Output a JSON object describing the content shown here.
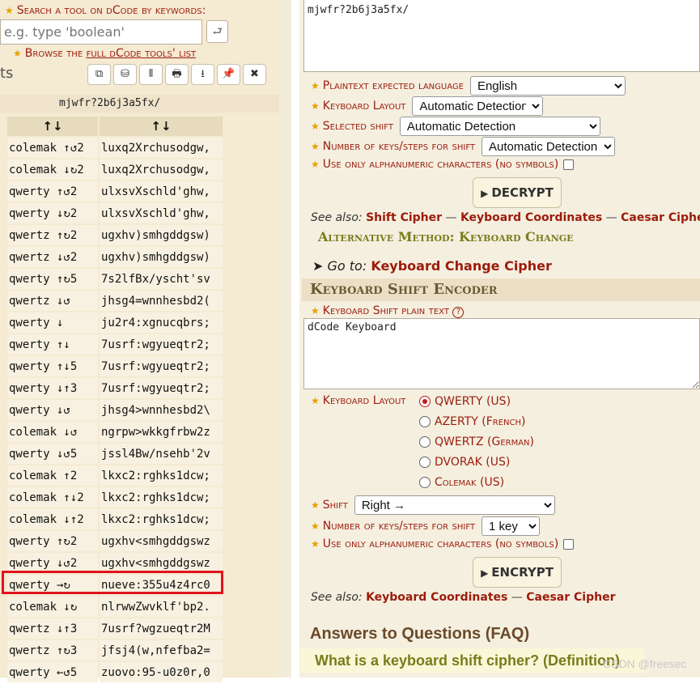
{
  "search": {
    "title": "Search a tool on dCode by keywords:",
    "placeholder": "e.g. type 'boolean'",
    "go_icon": "return-arrow-icon",
    "browse_prefix": "Browse the ",
    "browse_link": "full dCode tools' list"
  },
  "left_header": {
    "fragment": "ts",
    "tools": [
      {
        "name": "copy-icon",
        "glyph": "⧉"
      },
      {
        "name": "save-icon",
        "glyph": "⛁"
      },
      {
        "name": "columns-icon",
        "glyph": "⦀"
      },
      {
        "name": "print-icon",
        "glyph": "🖶"
      },
      {
        "name": "download-icon",
        "glyph": "⭳"
      },
      {
        "name": "pin-icon",
        "glyph": "📌"
      },
      {
        "name": "close-icon",
        "glyph": "✖"
      }
    ]
  },
  "result": {
    "input": "mjwfr?2b6j3a5fx/",
    "headers": [
      "↑↓",
      "↑↓"
    ],
    "rows": [
      [
        "colemak ↑↺2",
        "luxq2Xrchusodgw,"
      ],
      [
        "colemak ↓↻2",
        "luxq2Xrchusodgw,"
      ],
      [
        "qwerty ↑↺2",
        "ulxsvXschld'ghw,"
      ],
      [
        "qwerty ↓↻2",
        "ulxsvXschld'ghw,"
      ],
      [
        "qwertz ↑↻2",
        "ugxhv)smhgddgsw)"
      ],
      [
        "qwertz ↓↺2",
        "ugxhv)smhgddgsw)"
      ],
      [
        "qwerty ↑↻5",
        "7s2lfBx/yscht'sv"
      ],
      [
        "qwertz ↓↺",
        "jhsg4=wnnhesbd2("
      ],
      [
        "qwerty ↓",
        "ju2r4:xgnucqbrs;"
      ],
      [
        "qwerty ↑↓",
        "7usrf:wgyueqtr2;"
      ],
      [
        "qwerty ↑↓5",
        "7usrf:wgyueqtr2;"
      ],
      [
        "qwerty ↓↑3",
        "7usrf:wgyueqtr2;"
      ],
      [
        "qwerty ↓↺",
        "jhsg4>wnnhesbd2\\"
      ],
      [
        "colemak ↓↺",
        "ngrpw>wkkgfrbw2z"
      ],
      [
        "qwerty ↓↺5",
        "jssl4Bw/nsehb'2v"
      ],
      [
        "colemak ↑2",
        "lkxc2:rghks1dcw;"
      ],
      [
        "colemak ↑↓2",
        "lkxc2:rghks1dcw;"
      ],
      [
        "colemak ↓↑2",
        "lkxc2:rghks1dcw;"
      ],
      [
        "qwerty ↑↻2",
        "ugxhv<smhgddgswz"
      ],
      [
        "qwerty ↓↺2",
        "ugxhv<smhgddgswz"
      ],
      [
        "qwerty →↻",
        "nueve:355u4z4rc0"
      ],
      [
        "colemak ↓↻",
        "nlrwwZwvklf'bp2."
      ],
      [
        "qwertz ↓↑3",
        "7usrf?wgzueqtr2M"
      ],
      [
        "qwertz ↑↻3",
        "jfsj4(w,nfefba2="
      ],
      [
        "qwerty ←↺5",
        "zuovo:95-u0z0r,0"
      ]
    ]
  },
  "decoder": {
    "ciphertext": "mjwfr?2b6j3a5fx/",
    "plaintext_lang_label": "Plaintext expected language",
    "plaintext_lang_value": "English",
    "layout_label": "Keyboard Layout",
    "layout_value": "Automatic Detection",
    "shift_label": "Selected shift",
    "shift_value": "Automatic Detection",
    "steps_label": "Number of keys/steps for shift",
    "steps_value": "Automatic Detection",
    "alnum_label": "Use only alphanumeric characters (no symbols)",
    "decrypt_label": "DECRYPT",
    "see_also_label": "See also:",
    "see_also": [
      "Shift Cipher",
      "Keyboard Coordinates",
      "Caesar Cipher"
    ],
    "alt_method": "Alternative Method: Keyboard Change",
    "goto_label": "Go to:",
    "goto_link": "Keyboard Change Cipher"
  },
  "encoder": {
    "title": "Keyboard Shift Encoder",
    "plain_label": "Keyboard Shift plain text",
    "help_icon": "?",
    "plain_value": "dCode Keyboard",
    "layout_label": "Keyboard Layout",
    "layouts": [
      "QWERTY (US)",
      "AZERTY (French)",
      "QWERTZ (German)",
      "DVORAK (US)",
      "Colemak (US)"
    ],
    "shift_label": "Shift",
    "shift_value": "Right →",
    "steps_label": "Number of keys/steps for shift",
    "steps_value": "1 key",
    "alnum_label": "Use only alphanumeric characters (no symbols)",
    "encrypt_label": "ENCRYPT",
    "see_also_label": "See also:",
    "see_also": [
      "Keyboard Coordinates",
      "Caesar Cipher"
    ]
  },
  "faq": {
    "title": "Answers to Questions (FAQ)",
    "question": "What is a keyboard shift cipher? (Definition)"
  },
  "watermark": "CSDN @freesec",
  "colors": {
    "accent": "#9b1c0c",
    "highlight_border": "#e0141b",
    "panel_bg": "#f5ead2"
  }
}
